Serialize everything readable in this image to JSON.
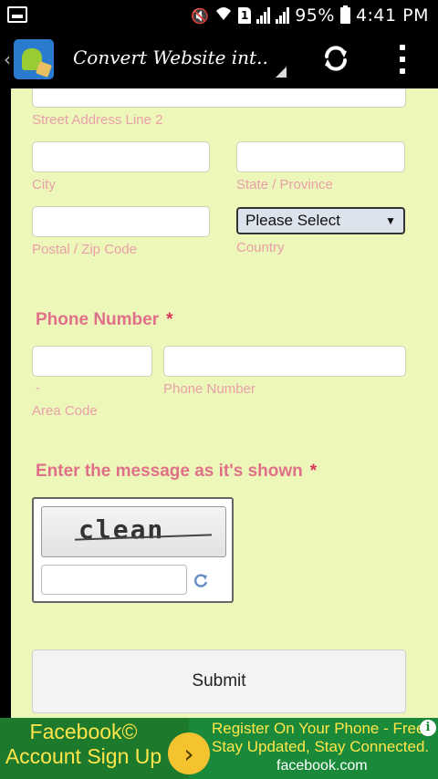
{
  "status_bar": {
    "battery": "95%",
    "time": "4:41 PM",
    "sim_slot": "1"
  },
  "action_bar": {
    "title": "Convert Website int..",
    "app_icon": "app-android-icon",
    "refresh_icon": "refresh-icon",
    "overflow_icon": "overflow-menu-icon"
  },
  "form": {
    "street_line2_label": "Street Address Line 2",
    "city_label": "City",
    "state_label": "State / Province",
    "postal_label": "Postal / Zip Code",
    "country_label": "Country",
    "country_select": {
      "selected": "Please Select",
      "arrow": "▼"
    },
    "phone_section_label": "Phone Number",
    "phone_required": "*",
    "area_code_dash": "-",
    "area_code_label": "Area Code",
    "phone_number_label": "Phone Number",
    "captcha_section_label": "Enter the message as it's shown",
    "captcha_required": "*",
    "captcha_word": "clean",
    "submit_label": "Submit"
  },
  "ad": {
    "left_text": "Facebook© Account Sign Up",
    "arrow": "›",
    "line1": "Register On Your Phone - Free",
    "line2": "Stay Updated, Stay Connected.",
    "domain": "facebook.com",
    "info": "i"
  },
  "colors": {
    "form_background": "#eef7ba",
    "section_label": "#e0708a",
    "required": "#d8345a",
    "sub_label": "#e8a0a8",
    "ad_green": "#1a8a3a",
    "ad_yellow": "#ffe54a"
  }
}
